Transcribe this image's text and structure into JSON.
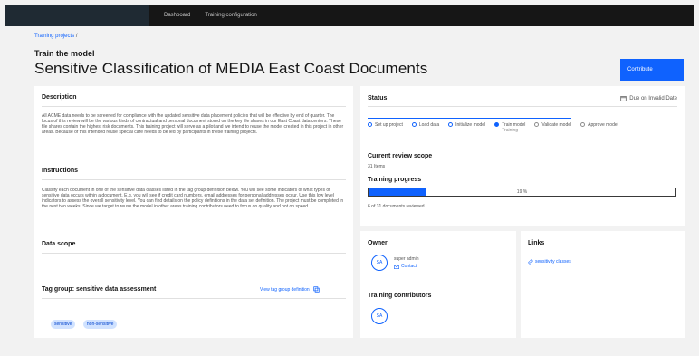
{
  "topbar": {
    "nav": [
      "Dashboard",
      "Training configuration"
    ]
  },
  "breadcrumb": {
    "parent": "Training projects",
    "separator": "/"
  },
  "header": {
    "subtitle": "Train the model",
    "title": "Sensitive Classification of MEDIA East Coast Documents",
    "contribute_label": "Contribute"
  },
  "description": {
    "title": "Description",
    "text": "All ACME data needs to be screened for compliance with the updated sensitive data placement policies that will be effective by end of quarter. The focus of this review will be the various kinds of contractual and personal document stored on the key file shares in our East Coast data centers. These file shares contain the highest risk documents. This training project will serve as a pilot and we intend to reuse the model created in this project in other areas. Because of this intended reuse special care needs to be led by participants in these training projects."
  },
  "instructions": {
    "title": "Instructions",
    "text": "Classify each document in one of the sensitive data classes listed in the tag group definition below. You will see some indicators of what types of sensitive data occurs within a document. E.g. you will see if credit card numbers, email addresses for personal addresses occur. Use this low level indicators to assess the overall sensitivity level. You can find details on the policy definitions in the data set definition. The project must be completed in the next two weeks. Since we target to reuse the model in other areas training contributors need to focus on quality and not on speed."
  },
  "data_scope": {
    "title": "Data scope"
  },
  "tag_group": {
    "title": "Tag group: sensitive data assessment",
    "view_link": "View tag group definition",
    "tags": [
      "sensitive",
      "non-sensitive"
    ]
  },
  "status": {
    "title": "Status",
    "due": "Due on Invalid Date",
    "steps": [
      {
        "label": "Set up project",
        "state": "done"
      },
      {
        "label": "Load data",
        "state": "done"
      },
      {
        "label": "Initialize model",
        "state": "done"
      },
      {
        "label": "Train model",
        "sub": "Training",
        "state": "current"
      },
      {
        "label": "Validate model",
        "state": "todo"
      },
      {
        "label": "Approve model",
        "state": "todo"
      }
    ],
    "review_scope_title": "Current review scope",
    "review_scope_value": "31 Items",
    "training_progress_title": "Training progress",
    "progress_percent": 19,
    "progress_label": "19 %",
    "progress_caption": "6 of 31 documents reviewed"
  },
  "owner": {
    "title": "Owner",
    "initials": "SA",
    "name": "super admin",
    "contact_label": "Contact",
    "contributors_title": "Training contributors",
    "contributor_initials": "SA"
  },
  "links": {
    "title": "Links",
    "items": [
      "sensitivity classes"
    ]
  },
  "colors": {
    "accent": "#0f62fe",
    "topbar": "#161616",
    "background": "#f2f2f2"
  }
}
